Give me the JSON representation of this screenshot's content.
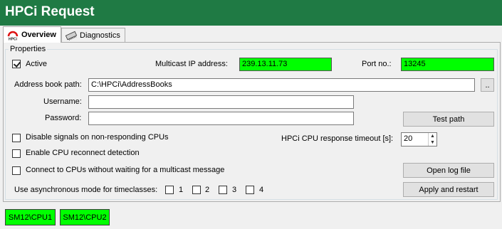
{
  "window": {
    "title": "HPCi Request"
  },
  "tabs": [
    {
      "label": "Overview",
      "icon": "hpci-logo-icon",
      "active": true
    },
    {
      "label": "Diagnostics",
      "icon": "network-card-icon",
      "active": false
    }
  ],
  "properties": {
    "legend": "Properties",
    "active": {
      "label": "Active",
      "checked": true
    },
    "multicast_ip": {
      "label": "Multicast IP address:",
      "value": "239.13.11.73"
    },
    "port": {
      "label": "Port no.:",
      "value": "13245"
    },
    "address_book": {
      "label": "Address book path:",
      "value": "C:\\HPCi\\AddressBooks",
      "browse_label": ".."
    },
    "username": {
      "label": "Username:",
      "value": ""
    },
    "password": {
      "label": "Password:",
      "value": ""
    },
    "test_path_label": "Test path",
    "disable_signals": {
      "label": "Disable signals on non-responding CPUs",
      "checked": false
    },
    "timeout": {
      "label": "HPCi CPU response timeout [s]:",
      "value": "20"
    },
    "reconnect": {
      "label": "Enable CPU reconnect detection",
      "checked": false
    },
    "connect_without_multicast": {
      "label": "Connect to CPUs without waiting for a multicast message",
      "checked": false
    },
    "open_log_label": "Open log file",
    "async_mode": {
      "label": "Use asynchronous mode for timeclasses:",
      "options": [
        {
          "label": "1",
          "checked": false
        },
        {
          "label": "2",
          "checked": false
        },
        {
          "label": "3",
          "checked": false
        },
        {
          "label": "4",
          "checked": false
        }
      ]
    },
    "apply_label": "Apply and restart"
  },
  "cpus": [
    {
      "label": "SM12\\CPU1",
      "status_color": "#00ff00"
    },
    {
      "label": "SM12\\CPU2",
      "status_color": "#00ff00"
    }
  ],
  "colors": {
    "titlebar": "#1f7a44",
    "ok": "#00ff00"
  }
}
